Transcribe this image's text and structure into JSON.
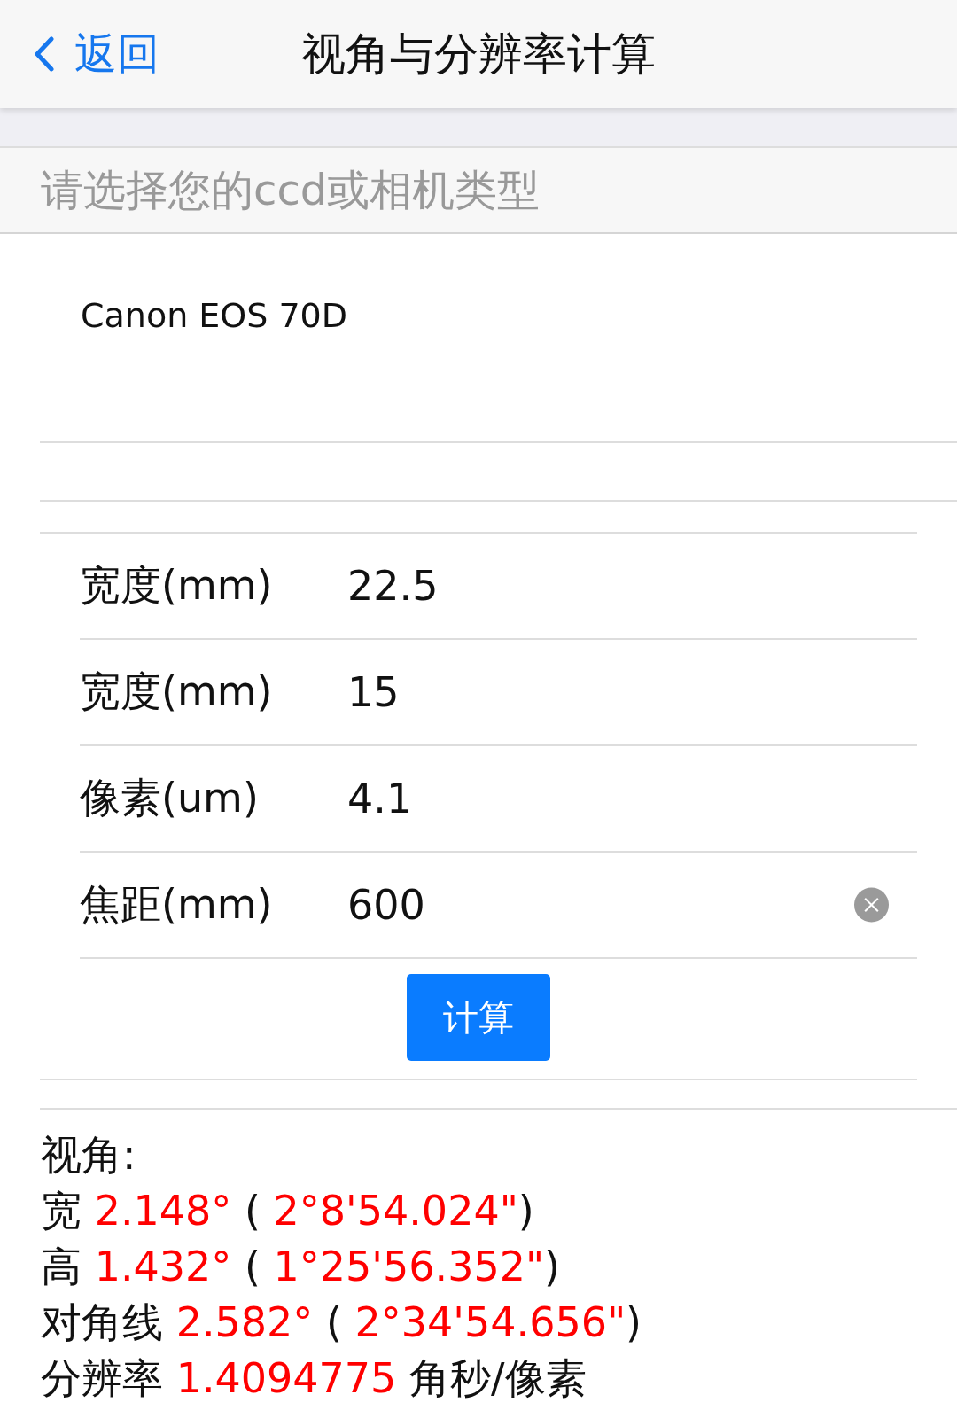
{
  "nav": {
    "back": "返回",
    "title": "视角与分辨率计算"
  },
  "camera_section": {
    "header": "请选择您的ccd或相机类型",
    "selected_camera": "Canon EOS 70D"
  },
  "fields": [
    {
      "label": "宽度(mm)",
      "value": "22.5",
      "clear_button": false
    },
    {
      "label": "宽度(mm)",
      "value": "15",
      "clear_button": false
    },
    {
      "label": "像素(um)",
      "value": "4.1",
      "clear_button": false
    },
    {
      "label": "焦距(mm)",
      "value": "600",
      "clear_button": true
    }
  ],
  "calculate_button": "计算",
  "results": [
    [
      {
        "text": "视角:",
        "highlight": false
      }
    ],
    [
      {
        "text": "宽 ",
        "highlight": false
      },
      {
        "text": "2.148°",
        "highlight": true
      },
      {
        "text": " ( ",
        "highlight": false
      },
      {
        "text": "2°8'54.024\"",
        "highlight": true
      },
      {
        "text": ")",
        "highlight": false
      }
    ],
    [
      {
        "text": "高 ",
        "highlight": false
      },
      {
        "text": "1.432°",
        "highlight": true
      },
      {
        "text": " ( ",
        "highlight": false
      },
      {
        "text": "1°25'56.352\"",
        "highlight": true
      },
      {
        "text": ")",
        "highlight": false
      }
    ],
    [
      {
        "text": "对角线 ",
        "highlight": false
      },
      {
        "text": "2.582°",
        "highlight": true
      },
      {
        "text": " ( ",
        "highlight": false
      },
      {
        "text": "2°34'54.656\"",
        "highlight": true
      },
      {
        "text": ")",
        "highlight": false
      }
    ],
    [
      {
        "text": "分辨率 ",
        "highlight": false
      },
      {
        "text": "1.4094775",
        "highlight": true
      },
      {
        "text": " 角秒/像素",
        "highlight": false
      }
    ]
  ]
}
